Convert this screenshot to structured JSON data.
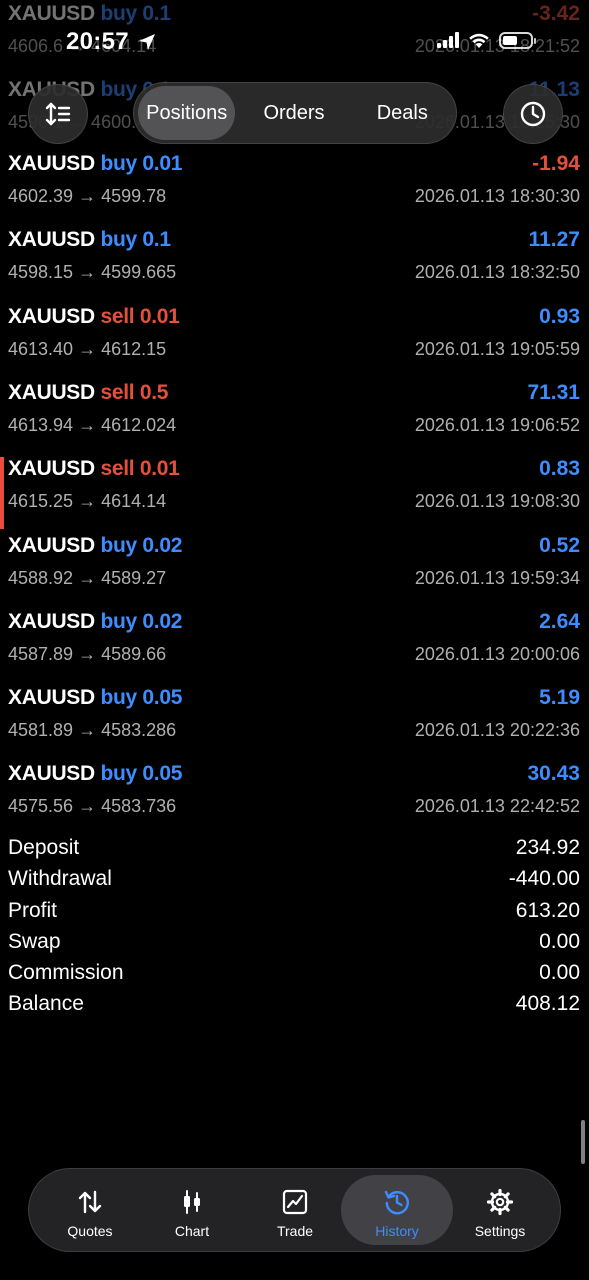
{
  "status_bar": {
    "time": "20:57"
  },
  "tabs_top": {
    "positions": "Positions",
    "orders": "Orders",
    "deals": "Deals",
    "active": "Positions"
  },
  "deals": [
    {
      "symbol": "XAUUSD",
      "side": "buy",
      "volume": "0.1",
      "profit": "-3.42",
      "prices": "4606.6 → 4604.14",
      "time": "2026.01.13 18:21:52"
    },
    {
      "symbol": "XAUUSD",
      "side": "buy",
      "volume": "0.1",
      "profit": "11.13",
      "prices": "4596.1 → 4600.43",
      "time": "2026.01.13 18:25:30"
    },
    {
      "symbol": "XAUUSD",
      "side": "buy",
      "volume": "0.01",
      "profit": "-1.94",
      "prices": "4602.39 → 4599.78",
      "time": "2026.01.13 18:30:30"
    },
    {
      "symbol": "XAUUSD",
      "side": "buy",
      "volume": "0.1",
      "profit": "11.27",
      "prices": "4598.15 → 4599.665",
      "time": "2026.01.13 18:32:50"
    },
    {
      "symbol": "XAUUSD",
      "side": "sell",
      "volume": "0.01",
      "profit": "0.93",
      "prices": "4613.40 → 4612.15",
      "time": "2026.01.13 19:05:59"
    },
    {
      "symbol": "XAUUSD",
      "side": "sell",
      "volume": "0.5",
      "profit": "71.31",
      "prices": "4613.94 → 4612.024",
      "time": "2026.01.13 19:06:52"
    },
    {
      "symbol": "XAUUSD",
      "side": "sell",
      "volume": "0.01",
      "profit": "0.83",
      "prices": "4615.25 → 4614.14",
      "time": "2026.01.13 19:08:30"
    },
    {
      "symbol": "XAUUSD",
      "side": "buy",
      "volume": "0.02",
      "profit": "0.52",
      "prices": "4588.92 → 4589.27",
      "time": "2026.01.13 19:59:34"
    },
    {
      "symbol": "XAUUSD",
      "side": "buy",
      "volume": "0.02",
      "profit": "2.64",
      "prices": "4587.89 → 4589.66",
      "time": "2026.01.13 20:00:06"
    },
    {
      "symbol": "XAUUSD",
      "side": "buy",
      "volume": "0.05",
      "profit": "5.19",
      "prices": "4581.89 → 4583.286",
      "time": "2026.01.13 20:22:36"
    },
    {
      "symbol": "XAUUSD",
      "side": "buy",
      "volume": "0.05",
      "profit": "30.43",
      "prices": "4575.56 → 4583.736",
      "time": "2026.01.13 22:42:52"
    }
  ],
  "summary": [
    {
      "label": "Deposit",
      "value": "234.92"
    },
    {
      "label": "Withdrawal",
      "value": "-440.00"
    },
    {
      "label": "Profit",
      "value": "613.20"
    },
    {
      "label": "Swap",
      "value": "0.00"
    },
    {
      "label": "Commission",
      "value": "0.00"
    },
    {
      "label": "Balance",
      "value": "408.12"
    }
  ],
  "tabbar": {
    "quotes": "Quotes",
    "chart": "Chart",
    "trade": "Trade",
    "history": "History",
    "settings": "Settings",
    "active": "History"
  },
  "colors": {
    "buy": "#3f8cff",
    "sell": "#e5503d",
    "background": "#000000",
    "accent": "#3f8cff"
  },
  "icons": [
    "location-arrow-icon",
    "signal-icon",
    "wifi-icon",
    "battery-icon",
    "sort-icon",
    "clock-icon",
    "quotes-icon",
    "chart-icon",
    "trade-icon",
    "history-icon",
    "settings-icon"
  ]
}
